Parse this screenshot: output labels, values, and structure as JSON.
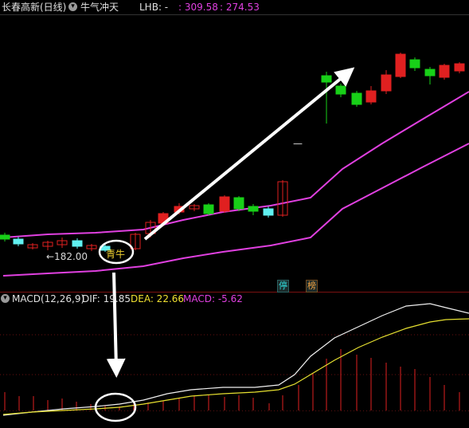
{
  "header": {
    "stock_name": "长春高新(日线)",
    "indicator_name": "牛气冲天",
    "lhb_label": "LHB: -",
    "value_1": ": 309.58",
    "value_2": ": 274.53"
  },
  "annotations": {
    "low_price": "←182.00",
    "signal_label": "青牛",
    "dash": "—"
  },
  "badges": {
    "limit": "停",
    "board": "榜"
  },
  "macd": {
    "title": "MACD(12,26,9)",
    "dif_label": "DIF: 19.85",
    "dea_label": "DEA: 22.66",
    "macd_label": "MACD: -5.62"
  },
  "colors": {
    "up": "#e02020",
    "down": "#18d018",
    "doji": "#60f0f0",
    "band": "#e040e0",
    "dif": "#f0f0f0",
    "dea": "#e6e030",
    "value": "#e040e0",
    "dea_text": "#f0e030",
    "arrow": "#ffffff"
  },
  "icons": {
    "collapse": "chevron-down-icon"
  }
}
